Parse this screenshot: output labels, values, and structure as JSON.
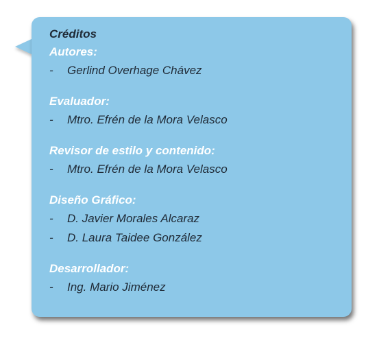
{
  "credits": {
    "title": "Créditos",
    "sections": [
      {
        "heading": "Autores:",
        "items": [
          "Gerlind Overhage Chávez"
        ]
      },
      {
        "heading": "Evaluador:",
        "items": [
          "Mtro. Efrén de la Mora Velasco"
        ]
      },
      {
        "heading": "Revisor de estilo y contenido:",
        "items": [
          "Mtro. Efrén de la Mora Velasco"
        ]
      },
      {
        "heading": "Diseño Gráfico:",
        "items": [
          "D. Javier Morales Alcaraz",
          "D. Laura Taidee González"
        ]
      },
      {
        "heading": "Desarrollador:",
        "items": [
          "Ing. Mario Jiménez"
        ]
      }
    ],
    "bullet": "-"
  },
  "colors": {
    "bubble": "#8dc8e8",
    "heading": "#ffffff",
    "text": "#1f2a36"
  }
}
